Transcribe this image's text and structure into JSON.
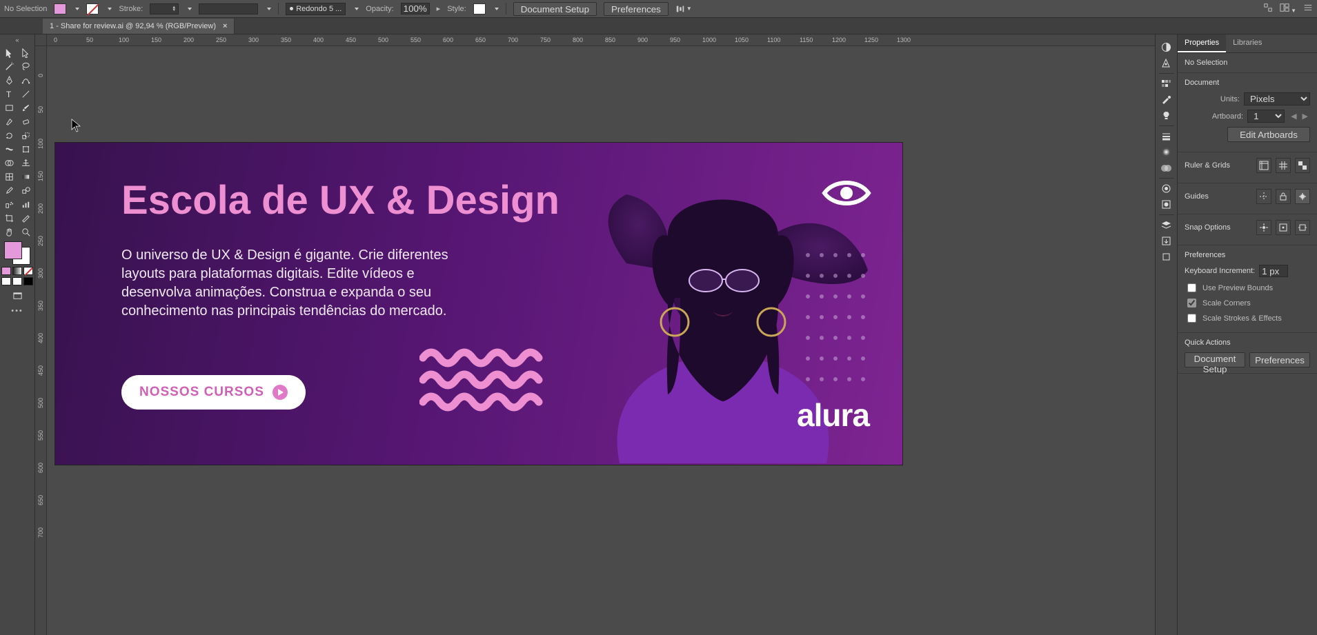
{
  "options_bar": {
    "selection_state": "No Selection",
    "fill_color": "#e49ada",
    "stroke_label": "Stroke:",
    "stroke_weight": "",
    "brush_label": "Redondo 5 ...",
    "opacity_label": "Opacity:",
    "opacity_value": "100%",
    "style_label": "Style:",
    "doc_setup": "Document Setup",
    "preferences": "Preferences"
  },
  "tab": {
    "title": "1 - Share for review.ai @ 92,94 % (RGB/Preview)"
  },
  "ruler_marks": [
    "0",
    "50",
    "100",
    "150",
    "200",
    "250",
    "300",
    "350",
    "400",
    "450",
    "500",
    "550",
    "600",
    "650",
    "700",
    "750",
    "800",
    "850",
    "900",
    "950",
    "1000",
    "1050",
    "1100",
    "1150",
    "1200",
    "1250",
    "1300"
  ],
  "ruler_marks_v": [
    "0",
    "50",
    "100",
    "150",
    "200",
    "250",
    "300",
    "350",
    "400",
    "450",
    "500",
    "550",
    "600",
    "650",
    "700"
  ],
  "artwork": {
    "heading": "Escola de UX & Design",
    "body": "O universo de UX & Design é gigante. Crie diferentes layouts para plataformas digitais. Edite vídeos e desenvolva animações. Construa e expanda o seu conhecimento nas principais tendências do mercado.",
    "cta": "NOSSOS CURSOS",
    "logo": "alura"
  },
  "properties": {
    "tab_properties": "Properties",
    "tab_libraries": "Libraries",
    "selection_state": "No Selection",
    "section_document": "Document",
    "units_label": "Units:",
    "units_value": "Pixels",
    "artboard_label": "Artboard:",
    "artboard_value": "1",
    "edit_artboards": "Edit Artboards",
    "ruler_grids": "Ruler & Grids",
    "guides": "Guides",
    "snap_options": "Snap Options",
    "section_prefs": "Preferences",
    "kbd_incr_label": "Keyboard Increment:",
    "kbd_incr_value": "1 px",
    "cb_preview": "Use Preview Bounds",
    "cb_scale_corners": "Scale Corners",
    "cb_scale_strokes": "Scale Strokes & Effects",
    "quick_actions": "Quick Actions",
    "qa_doc_setup": "Document Setup",
    "qa_prefs": "Preferences"
  }
}
